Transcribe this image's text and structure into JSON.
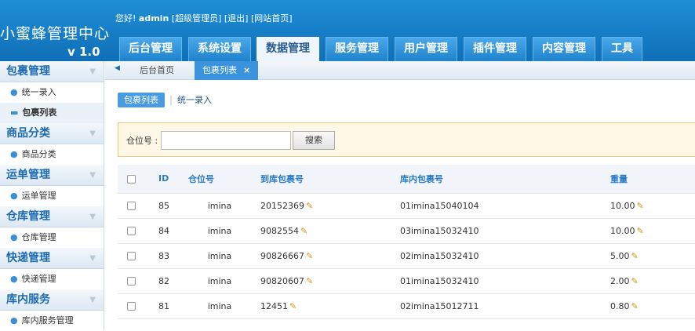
{
  "header": {
    "brand": "小蜜蜂管理中心",
    "version": "v 1.0",
    "welcome_prefix": "您好!",
    "username": "admin",
    "role": "[超级管理员]",
    "logout": "[退出]",
    "site_home": "[网站首页]",
    "nav": [
      "后台管理",
      "系统设置",
      "数据管理",
      "服务管理",
      "用户管理",
      "插件管理",
      "内容管理",
      "工具"
    ],
    "active_nav": "数据管理"
  },
  "sidebar": {
    "groups": [
      {
        "title": "包裹管理",
        "items": [
          "统一录入",
          "包裹列表"
        ]
      },
      {
        "title": "商品分类",
        "items": [
          "商品分类"
        ]
      },
      {
        "title": "运单管理",
        "items": [
          "运单管理"
        ]
      },
      {
        "title": "仓库管理",
        "items": [
          "仓库管理"
        ]
      },
      {
        "title": "快递管理",
        "items": [
          "快递管理"
        ]
      },
      {
        "title": "库内服务",
        "items": [
          "库内服务管理"
        ]
      }
    ],
    "current_item": "包裹列表"
  },
  "tabs": {
    "items": [
      "后台首页",
      "包裹列表"
    ],
    "active": "包裹列表",
    "close_glyph": "×"
  },
  "subnav": {
    "list_label": "包裹列表",
    "entry_label": "统一录入"
  },
  "search": {
    "label": "仓位号 :",
    "value": "",
    "button": "搜索"
  },
  "table": {
    "headers": [
      "ID",
      "仓位号",
      "到库包裹号",
      "库内包裹号",
      "重量"
    ],
    "rows": [
      {
        "id": "85",
        "position": "imina",
        "arrival_no": "20152369",
        "inner_no": "01imina15040104",
        "weight": "10.00"
      },
      {
        "id": "84",
        "position": "imina",
        "arrival_no": "9082554",
        "inner_no": "03imina15032410",
        "weight": "10.00"
      },
      {
        "id": "83",
        "position": "imina",
        "arrival_no": "90826667",
        "inner_no": "02imina15032410",
        "weight": "5.00"
      },
      {
        "id": "82",
        "position": "imina",
        "arrival_no": "90820607",
        "inner_no": "01imina15032410",
        "weight": "2.00"
      },
      {
        "id": "81",
        "position": "imina",
        "arrival_no": "12451",
        "inner_no": "02imina15012711",
        "weight": "0.80"
      }
    ]
  },
  "colors": {
    "header_bg": "#1a86d0",
    "accent": "#3a93dc",
    "search_bg": "#fff8e6"
  }
}
